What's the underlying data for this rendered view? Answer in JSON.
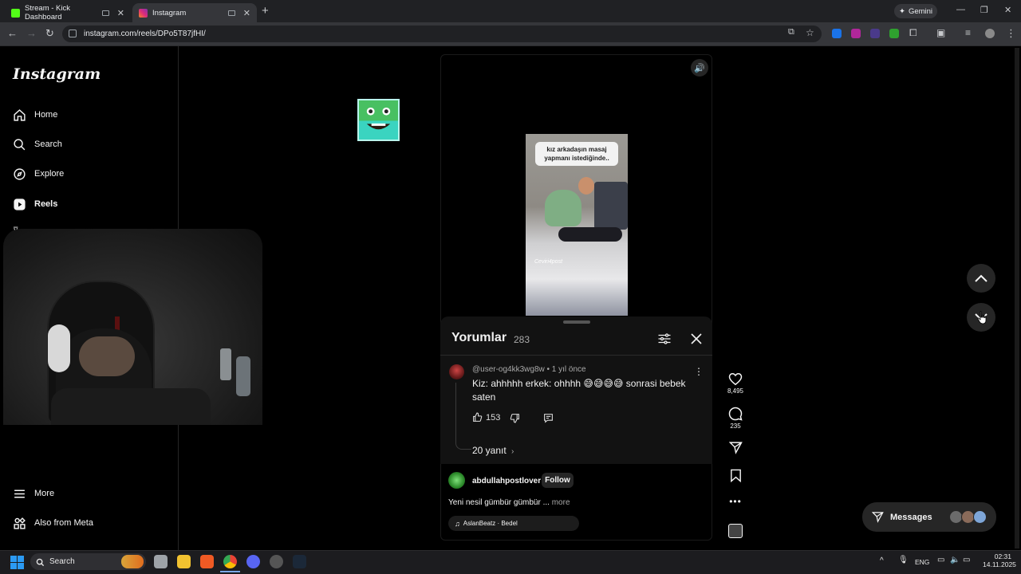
{
  "browser": {
    "tabs": [
      {
        "label": "Stream - Kick Dashboard",
        "favicon_color": "#53fc18"
      },
      {
        "label": "Instagram",
        "favicon_color": "#e1306c"
      }
    ],
    "new_tab": "+",
    "gemini_label": "Gemini",
    "url": "instagram.com/reels/DPo5T87jfHI/",
    "window_controls": {
      "minimize": "—",
      "restore": "❐",
      "close": "✕"
    }
  },
  "sidebar": {
    "logo": "Instagram",
    "items": [
      {
        "label": "Home",
        "icon": "home-icon"
      },
      {
        "label": "Search",
        "icon": "search-icon"
      },
      {
        "label": "Explore",
        "icon": "compass-icon"
      },
      {
        "label": "Reels",
        "icon": "reels-icon"
      },
      {
        "label": "More",
        "icon": "menu-icon"
      },
      {
        "label": "Also from Meta",
        "icon": "meta-icon"
      }
    ]
  },
  "reel": {
    "video_caption": "kız arkadaşın masaj yapmanı istediğinde..",
    "video_watermark": "Ceviri4post",
    "actions": {
      "likes": "8,495",
      "comments": "235"
    },
    "post": {
      "username": "abdullahpostlover",
      "separator": "•",
      "follow_label": "Follow",
      "caption": "Yeni nesil gümbür gümbür ...",
      "more_label": "more",
      "audio": "AslanBeatz · Bedel"
    }
  },
  "comments": {
    "title": "Yorumlar",
    "count": "283",
    "items": [
      {
        "author": "@user-og4kk3wg8w • 1 yıl önce",
        "text": "Kiz: ahhhhh erkek: ohhhh 😅😅😅😅 sonrasi bebek saten",
        "likes": "153",
        "replies": "20 yanıt"
      }
    ]
  },
  "messages": {
    "label": "Messages"
  },
  "taskbar": {
    "search_label": "Search",
    "lang": "ENG",
    "time": "02:31",
    "date": "14.11.2025"
  },
  "colors": {
    "accent": "#0095f6",
    "background": "#000000",
    "panel": "#121212"
  }
}
